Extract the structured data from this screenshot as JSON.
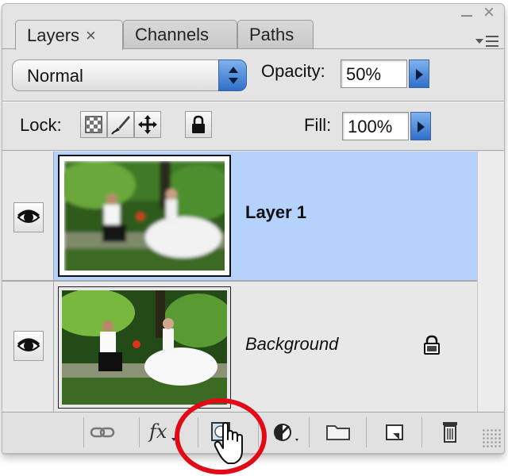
{
  "window": {
    "minimize_icon": "minimize-icon",
    "close_icon": "close-icon",
    "menu_icon": "panel-menu-icon"
  },
  "tabs": [
    {
      "label": "Layers",
      "close": "×",
      "active": true
    },
    {
      "label": "Channels",
      "active": false
    },
    {
      "label": "Paths",
      "active": false
    }
  ],
  "blend_mode": {
    "value": "Normal"
  },
  "opacity": {
    "label": "Opacity:",
    "value": "50%"
  },
  "lock": {
    "label": "Lock:",
    "icons": [
      "lock-transparent-pixels-icon",
      "lock-image-pixels-icon",
      "lock-position-icon",
      "lock-all-icon"
    ]
  },
  "fill": {
    "label": "Fill:",
    "value": "100%"
  },
  "layers": [
    {
      "name": "Layer 1",
      "selected": true,
      "visible": true,
      "locked": false
    },
    {
      "name": "Background",
      "selected": false,
      "visible": true,
      "locked": true
    }
  ],
  "toolbar": {
    "buttons": [
      "link-layers-icon",
      "layer-style-fx-icon",
      "add-layer-mask-icon",
      "adjustment-layer-icon",
      "new-group-icon",
      "new-layer-icon",
      "delete-layer-icon"
    ],
    "fx_label": "fx"
  },
  "colors": {
    "selection": "#b5d2fd",
    "accent_blue": "#2f6fc9",
    "annotation_red": "#e20a17",
    "panel_bg": "#e4e4e4"
  }
}
